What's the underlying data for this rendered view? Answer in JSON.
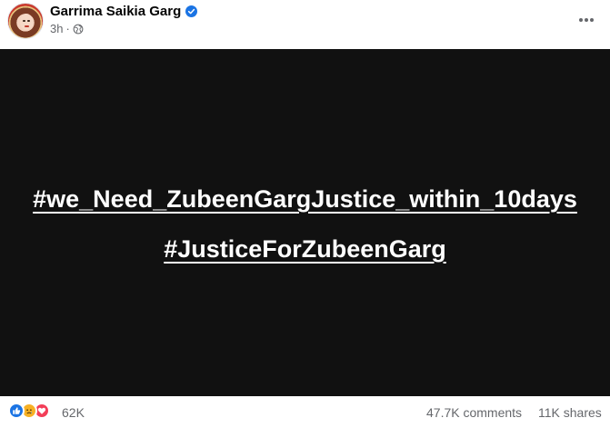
{
  "post": {
    "author": "Garrima Saikia Garg",
    "time": "3h",
    "separator": "·",
    "hashtags": [
      "#we_Need_ZubeenGargJustice_within_10days",
      "#JusticeForZubeenGarg"
    ]
  },
  "footer": {
    "reaction_count": "62K",
    "comments": "47.7K comments",
    "shares": "11K shares"
  },
  "icons": {
    "verified": "verified-badge-icon",
    "audience": "globe-icon",
    "more": "more-options-icon",
    "reactions": [
      "like-icon",
      "sad-icon",
      "love-icon"
    ]
  },
  "colors": {
    "media_background": "#111111",
    "verified_blue": "#1b74e4",
    "secondary_text": "#65676b",
    "like": "#1b74e4",
    "sad": "#f7b125",
    "love": "#f33e58"
  }
}
